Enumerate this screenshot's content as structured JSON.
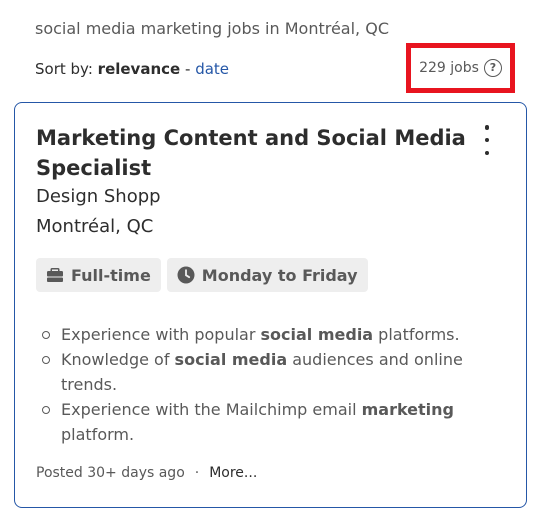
{
  "search_summary": "social media marketing jobs in Montréal, QC",
  "sort": {
    "prefix": "Sort by:",
    "active": "relevance",
    "separator": "-",
    "alternative": "date"
  },
  "results": {
    "count_text": "229 jobs",
    "help_glyph": "?"
  },
  "colors": {
    "link": "#2557a7",
    "card_border": "#2557a7",
    "highlight_box": "#e8141f"
  },
  "job": {
    "title": "Marketing Content and Social Media Specialist",
    "company": "Design Shopp",
    "location": "Montréal, QC",
    "tags": [
      {
        "icon": "briefcase-icon",
        "label": "Full-time"
      },
      {
        "icon": "clock-icon",
        "label": "Monday to Friday"
      }
    ],
    "snippet": [
      {
        "before": "Experience with popular ",
        "bold": "social media",
        "after": " platforms."
      },
      {
        "before": "Knowledge of ",
        "bold": "social media",
        "after": " audiences and online trends."
      },
      {
        "before": "Experience with the Mailchimp email ",
        "bold": "marketing",
        "after": " platform."
      }
    ],
    "posted": "Posted 30+ days ago",
    "footer_separator": "·",
    "more_link": "More..."
  }
}
